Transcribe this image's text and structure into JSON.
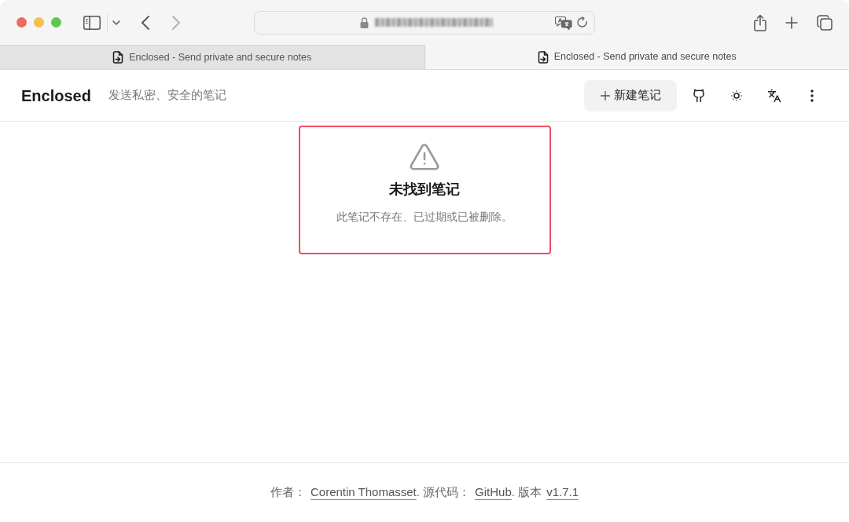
{
  "browser": {
    "forward_disabled": true,
    "tabs": [
      {
        "title": "Enclosed - Send private and secure notes",
        "selected": false
      },
      {
        "title": "Enclosed - Send private and secure notes",
        "selected": true
      }
    ]
  },
  "header": {
    "brand": "Enclosed",
    "tagline": "发送私密、安全的笔记",
    "new_note_button": "新建笔记"
  },
  "notice": {
    "title": "未找到笔记",
    "message": "此笔记不存在、已过期或已被删除。"
  },
  "footer": {
    "parts": [
      {
        "kind": "text",
        "text": "作者："
      },
      {
        "kind": "link",
        "text": "Corentin Thomasset"
      },
      {
        "kind": "text",
        "text": ". 源代码："
      },
      {
        "kind": "link",
        "text": "GitHub"
      },
      {
        "kind": "text",
        "text": ". 版本"
      },
      {
        "kind": "link",
        "text": "v1.7.1"
      }
    ]
  }
}
